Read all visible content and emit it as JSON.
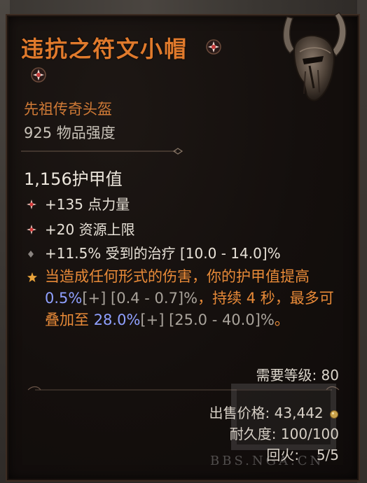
{
  "item": {
    "name": "违抗之符文小帽",
    "type": "先祖传奇头盔",
    "item_power": "925 物品强度",
    "armor": "1,156护甲值"
  },
  "affixes": [
    {
      "icon": "red-star-icon",
      "text": "+135 点力量"
    },
    {
      "icon": "red-star-icon",
      "text": "+20 资源上限"
    },
    {
      "icon": "grey-diamond-icon",
      "text": "+11.5% 受到的治疗 [10.0 - 14.0]%"
    }
  ],
  "aspect": {
    "icon": "orange-star-icon",
    "part1": "当造成任何形式的伤害，你的护甲值提高 ",
    "value1": "0.5%",
    "range1": "[+] [0.4 - 0.7]%",
    "part2": "，持续 4 秒，最多可叠加至 ",
    "value2": "28.0%",
    "range2": "[+] [25.0 - 40.0]%",
    "part3": "。"
  },
  "requirements": {
    "level": "需要等级: 80"
  },
  "footer": {
    "sell_price_label": "出售价格:",
    "sell_price_value": "43,442",
    "durability_label": "耐久度:",
    "durability_value": "100/100",
    "charges_label": "回火:",
    "charges_value": "5/5"
  },
  "watermark": "BBS.NGA.CN",
  "colors": {
    "legendary": "#e07a2c",
    "affix_blue": "#8fa0ff",
    "text": "#e8e2d8"
  }
}
